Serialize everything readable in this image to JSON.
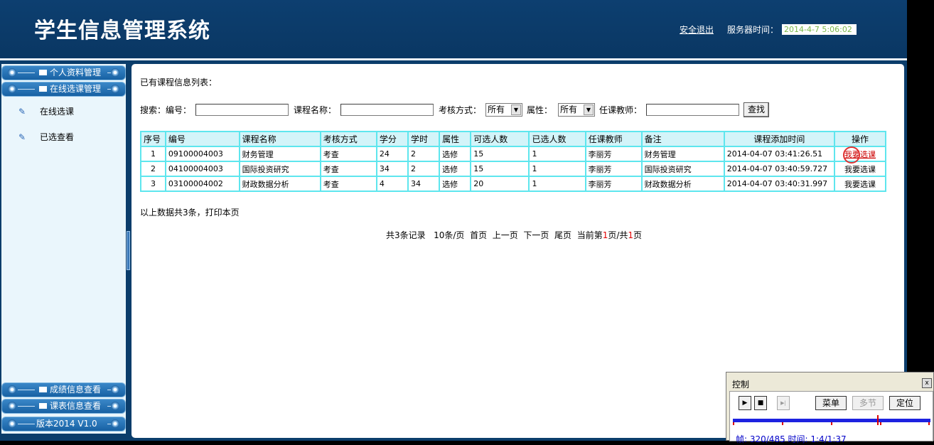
{
  "header": {
    "title": "学生信息管理系统",
    "logout": "安全退出",
    "server_time_label": "服务器时间：",
    "server_time_value": "2014-4-7 5:06:02"
  },
  "sidebar": {
    "sections_top": [
      "个人资料管理",
      "在线选课管理"
    ],
    "items": [
      "在线选课",
      "已选查看"
    ],
    "sections_bottom": [
      "成绩信息查看",
      "课表信息查看",
      "版本2014 V1.0"
    ]
  },
  "main": {
    "title": "已有课程信息列表：",
    "search": {
      "label": "搜索：",
      "code_label": "编号：",
      "name_label": "课程名称：",
      "exam_label": "考核方式：",
      "exam_value": "所有",
      "attr_label": "属性：",
      "attr_value": "所有",
      "teacher_label": "任课教师：",
      "search_button": "查找"
    },
    "table": {
      "headers": [
        "序号",
        "编号",
        "课程名称",
        "考核方式",
        "学分",
        "学时",
        "属性",
        "可选人数",
        "已选人数",
        "任课教师",
        "备注",
        "课程添加时间",
        "操作"
      ],
      "rows": [
        [
          "1",
          "09100004003",
          "财务管理",
          "考查",
          "24",
          "2",
          "选修",
          "15",
          "1",
          "李丽芳",
          "财务管理",
          "2014-04-07 03:41:26.51",
          "我要选课"
        ],
        [
          "2",
          "04100004003",
          "国际投资研究",
          "考查",
          "34",
          "2",
          "选修",
          "15",
          "1",
          "李丽芳",
          "国际投资研究",
          "2014-04-07 03:40:59.727",
          "我要选课"
        ],
        [
          "3",
          "03100004002",
          "财政数据分析",
          "考查",
          "4",
          "34",
          "选修",
          "20",
          "1",
          "李丽芳",
          "财政数据分析",
          "2014-04-07 03:40:31.997",
          "我要选课"
        ]
      ]
    },
    "summary": "以上数据共3条，打印本页",
    "pager": {
      "total": "共3条记录",
      "per_page": "10条/页",
      "first": "首页",
      "prev": "上一页",
      "next": "下一页",
      "last": "尾页",
      "current_prefix": "当前第",
      "current_page": "1",
      "current_mid": "页/共",
      "total_pages": "1",
      "current_suffix": "页"
    }
  },
  "control": {
    "title": "控制",
    "close": "x",
    "play": "▶",
    "stop": "■",
    "step": "▶|",
    "menu": "菜单",
    "multi": "多节",
    "locate": "定位",
    "status": "帧: 320/485 时间: 1:4/1:37"
  },
  "colors": {
    "header_bg": "#0b3d6b",
    "table_border": "#5ee6ee",
    "table_header": "#d3f4f9",
    "time_text": "#7ab84a"
  }
}
